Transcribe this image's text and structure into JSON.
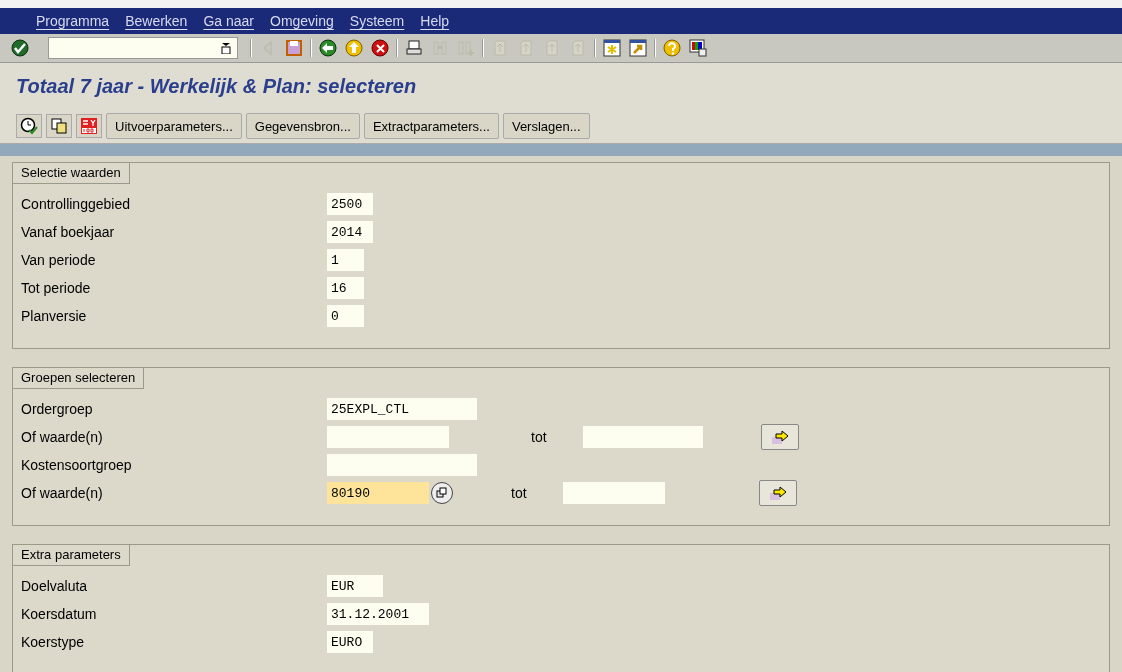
{
  "menu_bar": [
    "Programma",
    "Bewerken",
    "Ga naar",
    "Omgeving",
    "Systeem",
    "Help"
  ],
  "system_toolbar": {
    "icons": [
      {
        "kind": "check",
        "disabled": false
      },
      {
        "kind": "sep"
      },
      {
        "kind": "back-small",
        "disabled": true
      },
      {
        "kind": "save",
        "disabled": false
      },
      {
        "kind": "sep"
      },
      {
        "kind": "back",
        "disabled": false
      },
      {
        "kind": "exit",
        "disabled": false
      },
      {
        "kind": "cancel",
        "disabled": false
      },
      {
        "kind": "sep"
      },
      {
        "kind": "print",
        "disabled": false
      },
      {
        "kind": "find",
        "disabled": true
      },
      {
        "kind": "find-next",
        "disabled": true
      },
      {
        "kind": "sep"
      },
      {
        "kind": "first",
        "disabled": true
      },
      {
        "kind": "prev",
        "disabled": true
      },
      {
        "kind": "next",
        "disabled": true
      },
      {
        "kind": "last",
        "disabled": true
      },
      {
        "kind": "sep"
      },
      {
        "kind": "new-session",
        "disabled": false
      },
      {
        "kind": "shortcut",
        "disabled": false
      },
      {
        "kind": "sep"
      },
      {
        "kind": "help",
        "disabled": false
      },
      {
        "kind": "layout",
        "disabled": false
      }
    ]
  },
  "title": "Totaal 7 jaar - Werkelijk & Plan: selecteren",
  "app_toolbar": {
    "icons": [
      {
        "kind": "execute"
      },
      {
        "kind": "variant"
      },
      {
        "kind": "currency"
      }
    ],
    "buttons": [
      "Uitvoerparameters...",
      "Gegevensbron...",
      "Extractparameters...",
      "Verslagen..."
    ]
  },
  "groups": [
    {
      "title": "Selectie waarden",
      "fields": [
        {
          "kind": "single",
          "label": "Controllinggebied",
          "value": "2500",
          "focused": false
        },
        {
          "kind": "single",
          "label": "Vanaf boekjaar",
          "value": "2014",
          "focused": false
        },
        {
          "kind": "single",
          "label": "Van periode",
          "value": "1",
          "focused": false
        },
        {
          "kind": "single",
          "label": "Tot periode",
          "value": "16",
          "focused": false
        },
        {
          "kind": "single",
          "label": "Planversie",
          "value": "0",
          "focused": false
        }
      ]
    },
    {
      "title": "Groepen selecteren",
      "fields": [
        {
          "kind": "single",
          "label": "Ordergroep",
          "value": "25EXPL_CTL",
          "focused": false
        },
        {
          "kind": "range",
          "label": "Of waarde(n)",
          "to_label": "tot",
          "focused": false
        },
        {
          "kind": "single",
          "label": "Kostensoortgroep",
          "focused": false
        },
        {
          "kind": "range",
          "label": "Of waarde(n)",
          "value": "80190",
          "to_label": "tot",
          "focused": true
        }
      ]
    },
    {
      "title": "Extra parameters",
      "fields": [
        {
          "kind": "single",
          "label": "Doelvaluta",
          "value": "EUR",
          "focused": false
        },
        {
          "kind": "single",
          "label": "Koersdatum",
          "value": "31.12.2001",
          "focused": false
        },
        {
          "kind": "single",
          "label": "Koerstype",
          "value": "EURO",
          "focused": false
        }
      ]
    }
  ]
}
